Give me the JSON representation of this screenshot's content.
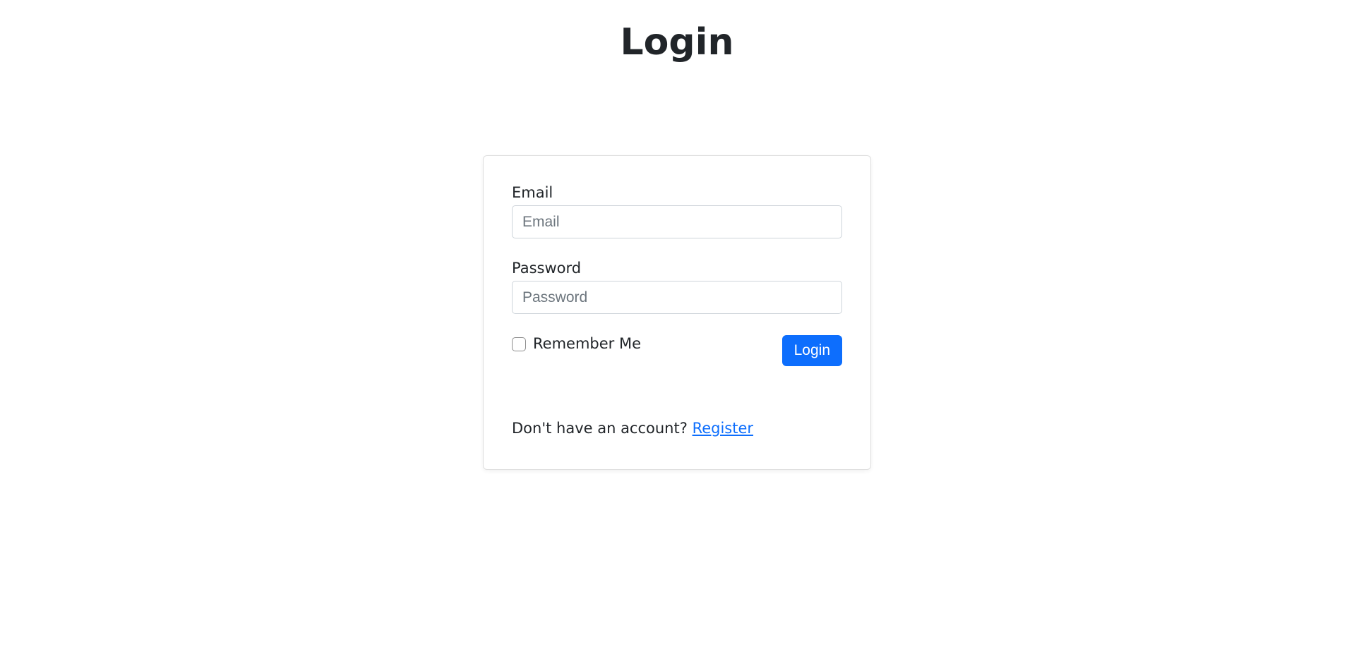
{
  "page": {
    "title": "Login"
  },
  "form": {
    "email": {
      "label": "Email",
      "placeholder": "Email",
      "value": ""
    },
    "password": {
      "label": "Password",
      "placeholder": "Password",
      "value": ""
    },
    "remember": {
      "label": "Remember Me",
      "checked": false
    },
    "submit_label": "Login"
  },
  "footer": {
    "prompt": "Don't have an account? ",
    "register_link_text": "Register"
  }
}
